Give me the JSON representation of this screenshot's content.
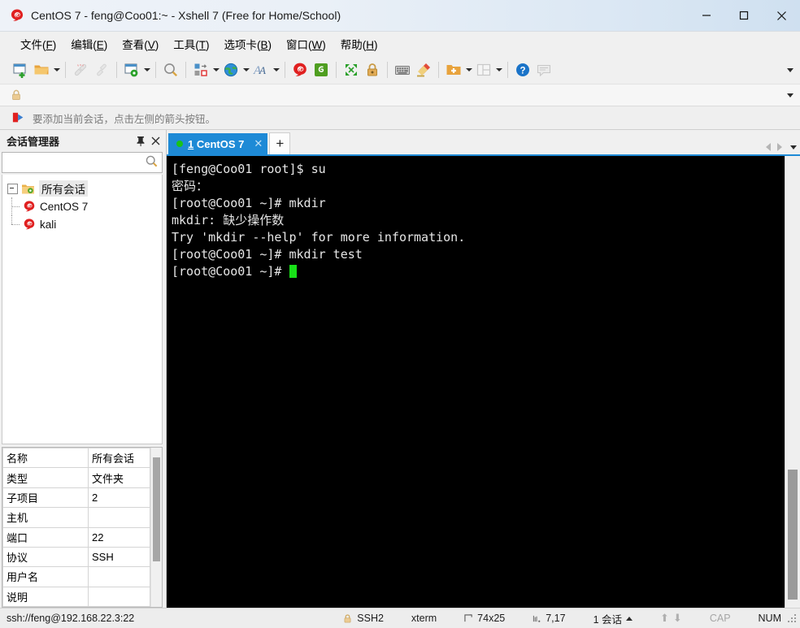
{
  "window": {
    "title": "CentOS 7 - feng@Coo01:~ - Xshell 7 (Free for Home/School)",
    "minimize_label": "—",
    "maximize_label": "□",
    "close_label": "✕"
  },
  "menubar": [
    {
      "label": "文件",
      "accel": "F"
    },
    {
      "label": "编辑",
      "accel": "E"
    },
    {
      "label": "查看",
      "accel": "V"
    },
    {
      "label": "工具",
      "accel": "T"
    },
    {
      "label": "选项卡",
      "accel": "B"
    },
    {
      "label": "窗口",
      "accel": "W"
    },
    {
      "label": "帮助",
      "accel": "H"
    }
  ],
  "toolbar": {
    "icons": [
      "new-session-icon",
      "open-folder-icon",
      "disconnect-icon",
      "reconnect-icon",
      "session-properties-icon",
      "find-icon",
      "transfer-file-icon",
      "web-browser-icon",
      "font-icon",
      "xshell-icon",
      "xftp-icon",
      "fullscreen-icon",
      "lock-icon",
      "keyboard-icon",
      "highlight-icon",
      "new-folder-icon",
      "layout-icon",
      "help-icon",
      "feedback-icon"
    ],
    "overflow_label": "toolbar-overflow"
  },
  "hintbar": {
    "text": "要添加当前会话，点击左侧的箭头按钮。"
  },
  "sidebar": {
    "title": "会话管理器",
    "pin_label": "pin",
    "close_label": "✕",
    "search_placeholder": "",
    "search_value": "",
    "tree": {
      "root": {
        "label": "所有会话",
        "icon": "folder-sessions-icon"
      },
      "children": [
        {
          "label": "CentOS 7",
          "icon": "xshell-session-icon"
        },
        {
          "label": "kali",
          "icon": "xshell-session-icon"
        }
      ]
    },
    "properties": [
      {
        "key": "名称",
        "value": "所有会话"
      },
      {
        "key": "类型",
        "value": "文件夹"
      },
      {
        "key": "子项目",
        "value": "2"
      },
      {
        "key": "主机",
        "value": ""
      },
      {
        "key": "端口",
        "value": "22"
      },
      {
        "key": "协议",
        "value": "SSH"
      },
      {
        "key": "用户名",
        "value": ""
      },
      {
        "key": "说明",
        "value": ""
      }
    ]
  },
  "tabs": {
    "items": [
      {
        "index": "1",
        "label": "CentOS 7",
        "status": "connected",
        "close_label": "✕"
      }
    ],
    "add_label": "+",
    "scroll_left_label": "scroll-left",
    "scroll_right_label": "scroll-right",
    "menu_label": "tab-list"
  },
  "terminal": {
    "lines": [
      "[feng@Coo01 root]$ su",
      "密码：",
      "[root@Coo01 ~]# mkdir",
      "mkdir: 缺少操作数",
      "Try 'mkdir --help' for more information.",
      "[root@Coo01 ~]# mkdir test",
      "[root@Coo01 ~]# "
    ],
    "background": "#000000",
    "foreground": "#e6e6e6",
    "cursor_color": "#18e018"
  },
  "statusbar": {
    "connection": "ssh://feng@192.168.22.3:22",
    "protocol": "SSH2",
    "term_type": "xterm",
    "size": "74x25",
    "cursor_pos": "7,17",
    "sessions": "1 会话",
    "cap": "CAP",
    "num": "NUM"
  }
}
